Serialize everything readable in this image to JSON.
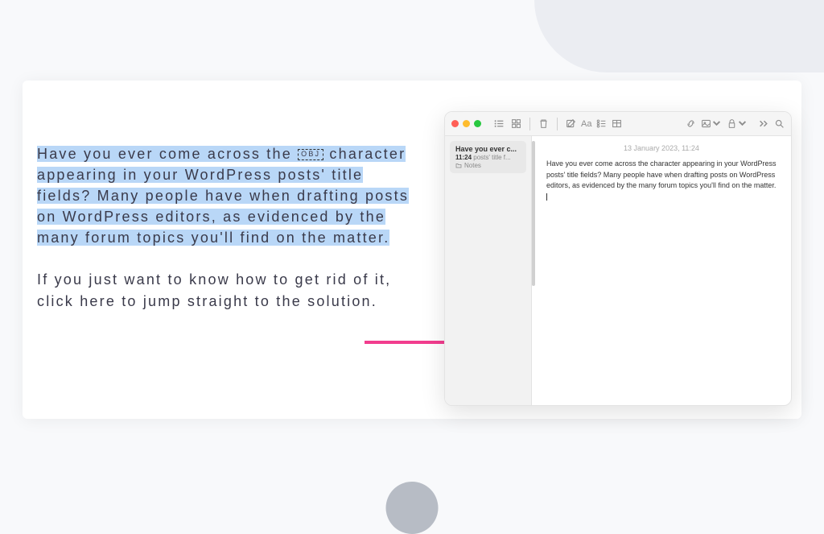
{
  "page": {
    "highlighted": "Have you ever come across the ",
    "obj": "OBJ",
    "highlighted2": " character appearing in your WordPress posts' title fields? Many people have when drafting posts on WordPress editors, as evidenced by the many forum topics you'll find on the matter.",
    "plain": "If you just want to know how to get rid of it, click here to jump straight to the solution."
  },
  "notes": {
    "sidebar": {
      "title": "Have you ever c...",
      "time": "11:24",
      "preview": "posts' title f...",
      "folder": "Notes"
    },
    "content": {
      "date": "13 January 2023, 11:24",
      "body": "Have you ever come across the  character appearing in your WordPress posts' title fields? Many people have when drafting posts on WordPress editors, as evidenced by the many forum topics you'll find on the matter."
    }
  }
}
